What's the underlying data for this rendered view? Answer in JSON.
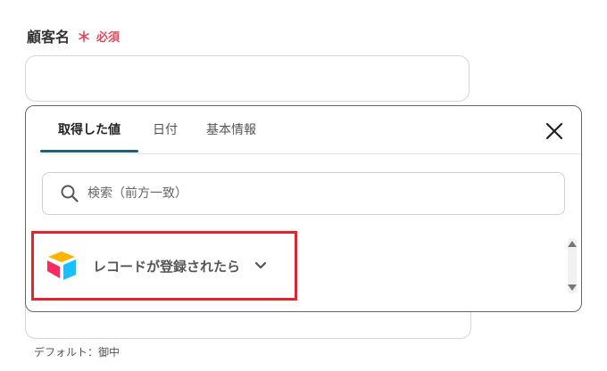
{
  "field": {
    "label": "顧客名",
    "required_mark": "＊",
    "required_text": "必須",
    "value": "",
    "default_hint": "デフォルト：御中"
  },
  "popup": {
    "tabs": [
      {
        "label": "取得した値",
        "active": true
      },
      {
        "label": "日付",
        "active": false
      },
      {
        "label": "基本情報",
        "active": false
      }
    ],
    "close_icon": "close-icon",
    "search": {
      "placeholder": "検索（前方一致）",
      "value": ""
    },
    "trigger": {
      "icon": "airtable-logo",
      "label": "レコードが登録されたら",
      "expand_icon": "chevron-down-icon"
    }
  },
  "colors": {
    "required": "#e04a5c",
    "active_tab": "#1f5f7a",
    "highlight": "#e0262c"
  }
}
